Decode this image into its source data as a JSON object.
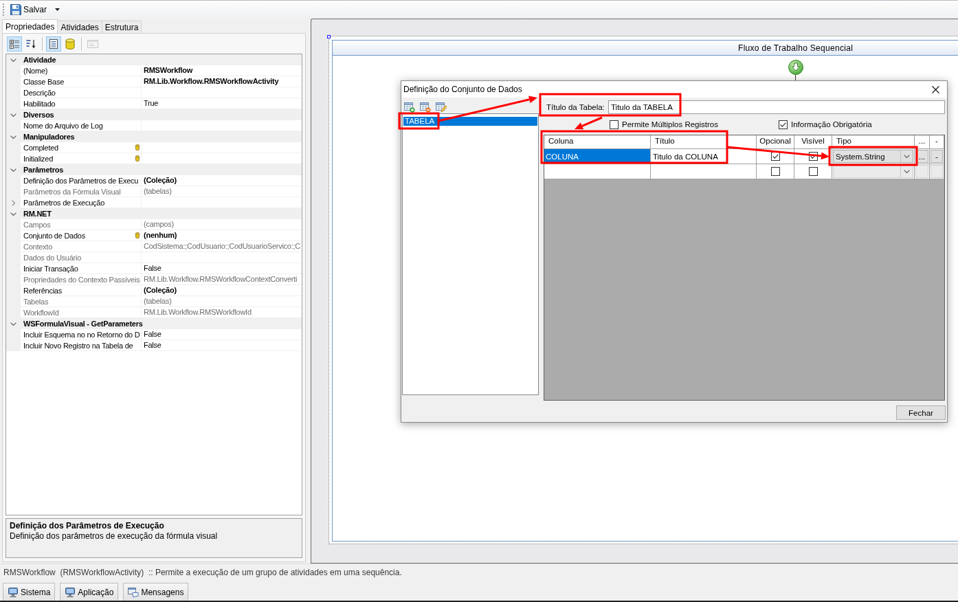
{
  "toolbar": {
    "save_label": "Salvar"
  },
  "left_tabs": [
    {
      "label": "Propriedades",
      "selected": true
    },
    {
      "label": "Atividades",
      "selected": false
    },
    {
      "label": "Estrutura",
      "selected": false
    }
  ],
  "property_toolbar": [
    {
      "kind": "categorized",
      "selected": true,
      "disabled": false
    },
    {
      "kind": "alphabetical",
      "selected": false,
      "disabled": false
    },
    {
      "kind": "properties",
      "selected": true,
      "disabled": false
    },
    {
      "kind": "events",
      "selected": false,
      "disabled": false
    },
    {
      "kind": "property_pages",
      "selected": false,
      "disabled": true
    }
  ],
  "property_grid": {
    "categories": [
      {
        "name": "Atividade",
        "expanded": true,
        "rows": [
          {
            "name": "(Nome)",
            "value": "RMSWorkflow",
            "bold": true,
            "readonly": false,
            "bound": false,
            "expandable": false
          },
          {
            "name": "Classe Base",
            "value": "RM.Lib.Workflow.RMSWorkflowActivity",
            "bold": true,
            "readonly": false,
            "bound": false,
            "expandable": false
          },
          {
            "name": "Descrição",
            "readonly": false,
            "bound": false,
            "expandable": false
          },
          {
            "name": "Habilitado",
            "value": "True",
            "bold": false,
            "readonly": false,
            "bound": false,
            "expandable": false
          }
        ]
      },
      {
        "name": "Diversos",
        "expanded": true,
        "rows": [
          {
            "name": "Nome do Arquivo de Log",
            "readonly": false,
            "bound": false,
            "expandable": false
          }
        ]
      },
      {
        "name": "Manipuladores",
        "expanded": true,
        "rows": [
          {
            "name": "Completed",
            "readonly": false,
            "bound": true,
            "expandable": false
          },
          {
            "name": "Initialized",
            "readonly": false,
            "bound": true,
            "expandable": false
          }
        ]
      },
      {
        "name": "Parâmetros",
        "expanded": true,
        "rows": [
          {
            "name": "Definição dos Parâmetros de Execu",
            "value": "(Coleção)",
            "bold": true,
            "readonly": false,
            "bound": false,
            "expandable": false
          },
          {
            "name": "Parâmetros da Fórmula Visual",
            "value": "(tabelas)",
            "bold": false,
            "readonly": true,
            "bound": false,
            "expandable": false
          },
          {
            "name": "Parâmetros de Execução",
            "readonly": false,
            "bound": false,
            "expandable": true
          }
        ]
      },
      {
        "name": "RM.NET",
        "expanded": true,
        "rows": [
          {
            "name": "Campos",
            "value": "(campos)",
            "bold": false,
            "readonly": true,
            "bound": false,
            "expandable": false
          },
          {
            "name": "Conjunto de Dados",
            "value": "(nenhum)",
            "bold": true,
            "readonly": false,
            "bound": true,
            "expandable": false
          },
          {
            "name": "Contexto",
            "value": "CodSistema:;CodUsuario:;CodUsuarioServico:;C",
            "bold": false,
            "readonly": true,
            "bound": false,
            "expandable": false
          },
          {
            "name": "Dados do Usuário",
            "readonly": true,
            "bound": false,
            "expandable": false
          },
          {
            "name": "Iniciar Transação",
            "value": "False",
            "bold": false,
            "readonly": false,
            "bound": false,
            "expandable": false
          },
          {
            "name": "Propriedades do Contexto Passíveis",
            "value": "RM.Lib.Workflow.RMSWorkflowContextConverti",
            "bold": false,
            "readonly": true,
            "bound": false,
            "expandable": false
          },
          {
            "name": "Referências",
            "value": "(Coleção)",
            "bold": true,
            "readonly": false,
            "bound": false,
            "expandable": false
          },
          {
            "name": "Tabelas",
            "value": "(tabelas)",
            "bold": false,
            "readonly": true,
            "bound": false,
            "expandable": false
          },
          {
            "name": "WorkflowId",
            "value": "RM.Lib.Workflow.RMSWorkflowId",
            "bold": false,
            "readonly": true,
            "bound": false,
            "expandable": false
          }
        ]
      },
      {
        "name": "WSFormulaVisual - GetParameters",
        "expanded": true,
        "rows": [
          {
            "name": "Incluir Esquema no no Retorno do D",
            "value": "False",
            "bold": false,
            "readonly": false,
            "bound": false,
            "expandable": false
          },
          {
            "name": "Incluir Novo Registro na Tabela de",
            "value": "False",
            "bold": false,
            "readonly": false,
            "bound": false,
            "expandable": false
          }
        ]
      }
    ]
  },
  "description": {
    "title": "Definição dos Parâmetros de Execução",
    "text": "Definição dos parâmetros de execução da fórmula visual"
  },
  "designer": {
    "title": "Fluxo de Trabalho Sequencial"
  },
  "dialog": {
    "title": "Definição do Conjunto de Dados",
    "table_list": [
      {
        "label": "TABELA",
        "selected": true
      }
    ],
    "table_title": {
      "label": "Título da Tabela:",
      "value": "Titulo da TABELA"
    },
    "options": [
      {
        "label": "Permite Múltiplos Registros",
        "checked": false
      },
      {
        "label": "Informação Obrigatória",
        "checked": true
      }
    ],
    "grid": {
      "columns": [
        "Coluna",
        "Título",
        "Opcional",
        "Visível",
        "Tipo",
        "...",
        "-"
      ],
      "rows": [
        {
          "coluna": "COLUNA",
          "titulo": "Titulo da COLUNA",
          "opcional": true,
          "visivel": true,
          "tipo": "System.String",
          "actions": [
            "...",
            "-"
          ],
          "selected": true,
          "disabled": false
        },
        {
          "opcional": false,
          "visivel": false,
          "selected": false,
          "disabled": true
        }
      ]
    },
    "close_button": "Fechar"
  },
  "status_bar": "RMSWorkflow  (RMSWorkflowActivity)  :: Permite a execução de um grupo de atividades em uma sequência.",
  "bottom_tabs": [
    {
      "label": "Sistema",
      "kind": "console"
    },
    {
      "label": "Aplicação",
      "kind": "console"
    },
    {
      "label": "Mensagens",
      "kind": "messages"
    }
  ]
}
